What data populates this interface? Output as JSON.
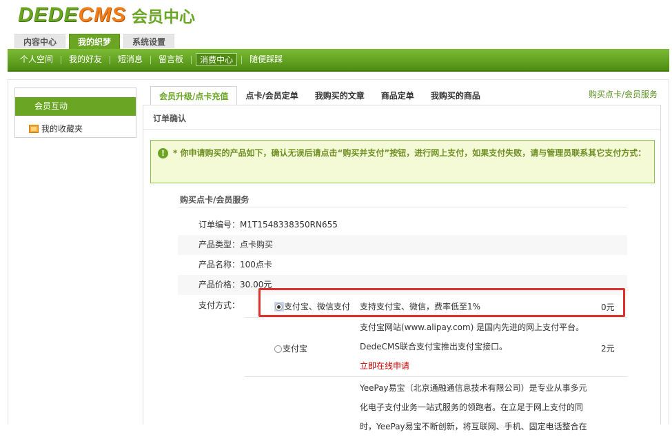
{
  "logo": {
    "dede": "DEDE",
    "cms": "CMS",
    "subtitle": "会员中心"
  },
  "top_tabs": [
    {
      "label": "内容中心",
      "active": false
    },
    {
      "label": "我的织梦",
      "active": true
    },
    {
      "label": "系统设置",
      "active": false
    }
  ],
  "sub_nav": [
    {
      "label": "个人空间",
      "active": false
    },
    {
      "label": "我的好友",
      "active": false
    },
    {
      "label": "短消息",
      "active": false
    },
    {
      "label": "留言板",
      "active": false
    },
    {
      "label": "消费中心",
      "active": true
    },
    {
      "label": "随便踩踩",
      "active": false
    }
  ],
  "sidebar": {
    "active_item": "会员互动",
    "items": [
      {
        "label": "我的收藏夹",
        "icon": "folder-icon"
      }
    ]
  },
  "tabs": [
    {
      "label": "会员升级/点卡充值",
      "active": true
    },
    {
      "label": "点卡/会员定单",
      "active": false
    },
    {
      "label": "我购买的文章",
      "active": false
    },
    {
      "label": "商品定单",
      "active": false
    },
    {
      "label": "我购买的商品",
      "active": false
    }
  ],
  "tab_right_link": "购买点卡/会员服务",
  "section_title": "订单确认",
  "notice": {
    "text": "* 你申请购买的产品如下，确认无误后请点击“购买并支付”按钮，进行网上支付，如果支付失败，请与管理员联系其它支付方式：",
    "icon": "exclamation-icon"
  },
  "order": {
    "title": "购买点卡/会员服务",
    "rows": [
      {
        "label": "订单编号：",
        "value": "M1T1548338350RN655"
      },
      {
        "label": "产品类型：",
        "value": "点卡购买"
      },
      {
        "label": "产品名称：",
        "value": "100点卡"
      },
      {
        "label": "产品价格：",
        "value": "30.00元"
      }
    ],
    "payment_label": "支付方式："
  },
  "payments": [
    {
      "name": "支付宝、微信支付",
      "checked": true,
      "desc": "支持支付宝、微信，费率低至1%",
      "fee": "0元"
    },
    {
      "name": "支付宝",
      "checked": false,
      "desc_lines": [
        "支付宝网站(www.alipay.com) 是国内先进的网上支付平台。",
        "DedeCMS联合支付宝推出支付宝接口。"
      ],
      "link": "立即在线申请",
      "fee": "2元"
    },
    {
      "name": "",
      "checked": false,
      "desc_lines": [
        "YeePay易宝（北京通融通信息技术有限公司）是专业从事多元",
        "化电子支付业务一站式服务的领跑者。在立足于网上支付的同",
        "时，YeePay易宝不断创新，将互联网、手机、固定电话整合在"
      ],
      "fee": ""
    }
  ],
  "colors": {
    "brand_green": "#6aa624",
    "brand_orange": "#f07d1a",
    "highlight_red": "#e0302d",
    "notice_bg": "#f4fad5"
  }
}
